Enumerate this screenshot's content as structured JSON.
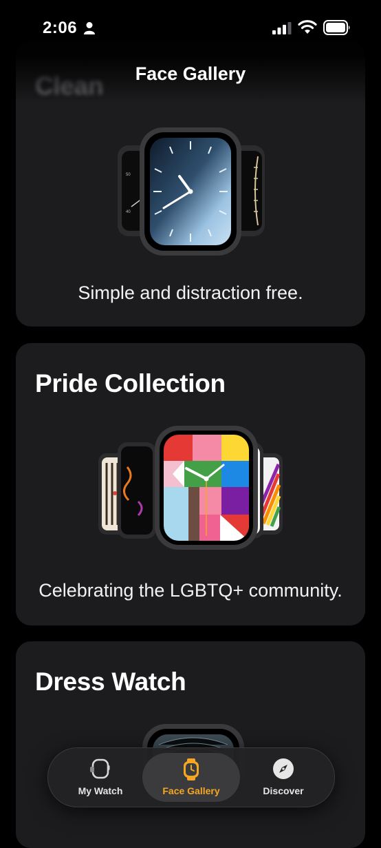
{
  "status_bar": {
    "time": "2:06"
  },
  "header": {
    "title": "Face Gallery"
  },
  "cards": [
    {
      "title": "Clean",
      "description": "Simple and distraction free."
    },
    {
      "title": "Pride Collection",
      "description": "Celebrating the LGBTQ+ community."
    },
    {
      "title": "Dress Watch",
      "description": ""
    }
  ],
  "tab_bar": {
    "tabs": [
      {
        "label": "My Watch",
        "icon": "watch-outline-icon",
        "active": false
      },
      {
        "label": "Face Gallery",
        "icon": "watch-face-icon",
        "active": true
      },
      {
        "label": "Discover",
        "icon": "compass-icon",
        "active": false
      }
    ],
    "accent_color": "#f5a623"
  }
}
